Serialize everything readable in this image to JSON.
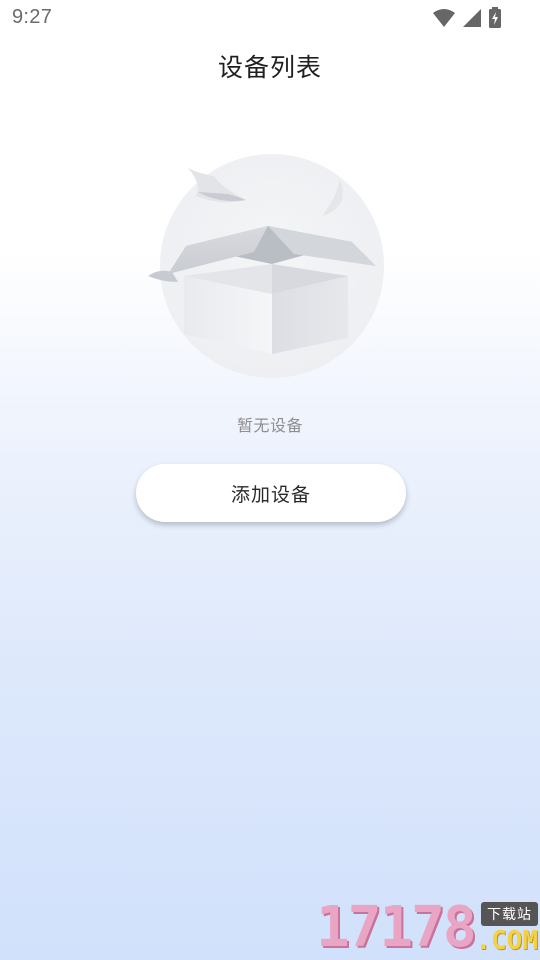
{
  "status_bar": {
    "time": "9:27",
    "icons": [
      "wifi-icon",
      "signal-icon",
      "battery-charging-icon"
    ]
  },
  "header": {
    "title": "设备列表"
  },
  "empty_state": {
    "illustration": "empty-box-icon",
    "message": "暂无设备"
  },
  "actions": {
    "add_device_label": "添加设备"
  },
  "watermark": {
    "digits": "17178",
    "badge": "下载站",
    "domain": ".COM"
  },
  "colors": {
    "background_top": "#ffffff",
    "background_bottom": "#d1e1fb",
    "empty_text": "#8e8e8e",
    "button_bg": "#ffffff"
  }
}
